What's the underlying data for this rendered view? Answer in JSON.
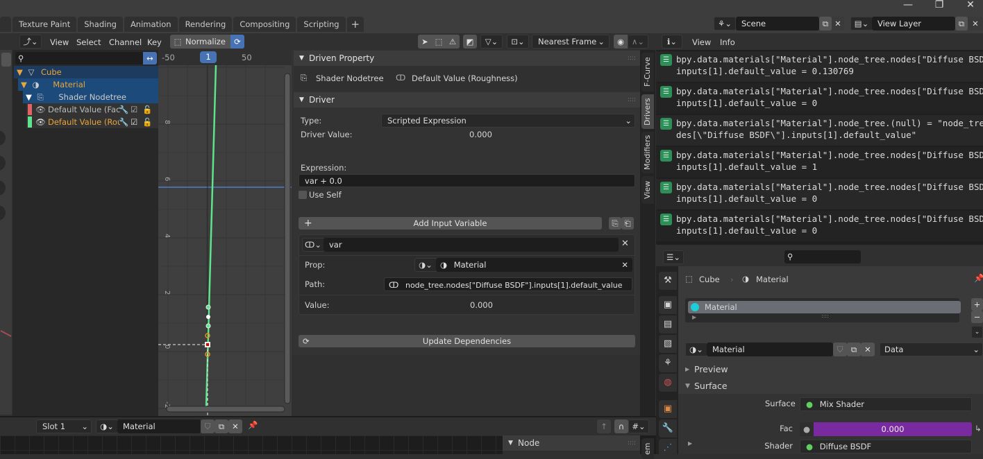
{
  "workspace_tabs": [
    "Texture Paint",
    "Shading",
    "Animation",
    "Rendering",
    "Compositing",
    "Scripting"
  ],
  "workspace_add": "+",
  "window_controls": {
    "minimize": "—",
    "maximize": "❐",
    "close": "✕"
  },
  "scene": {
    "icon": "scene-icon",
    "name": "Scene",
    "view_layer": "View Layer"
  },
  "graph_editor": {
    "menus": [
      "View",
      "Select",
      "Channel",
      "Key"
    ],
    "normalize_label": "Normalize",
    "snap_mode": "Nearest Frame",
    "frame_ruler": {
      "ticks": [
        "-50",
        "50"
      ],
      "current_frame": "1"
    },
    "y_ticks": [
      "8",
      "6",
      "4",
      "2",
      "0",
      "-2"
    ],
    "search_placeholder": ""
  },
  "outliner": {
    "items": [
      {
        "label": "Cube",
        "level": 0,
        "icon": "object-icon"
      },
      {
        "label": "Material",
        "level": 1,
        "icon": "material-icon"
      },
      {
        "label": "Shader Nodetree",
        "level": 2,
        "icon": "nodetree-icon"
      },
      {
        "label": "Default Value (Fac)",
        "level": 3,
        "color": "#e06060"
      },
      {
        "label": "Default Value (Roug",
        "level": 3,
        "color": "#5fe38c",
        "active": true
      }
    ]
  },
  "driven_property": {
    "title": "Driven Property",
    "owner": "Shader Nodetree",
    "property": "Default Value (Roughness)"
  },
  "driver": {
    "title": "Driver",
    "type_label": "Type:",
    "type_value": "Scripted Expression",
    "driver_value_label": "Driver Value:",
    "driver_value": "0.000",
    "expression_label": "Expression:",
    "expression": "var + 0.0",
    "use_self_label": "Use Self",
    "use_self": false,
    "add_variable_label": "Add Input Variable",
    "variable": {
      "name": "var",
      "prop_label": "Prop:",
      "prop_value": "Material",
      "path_label": "Path:",
      "path_value": "node_tree.nodes[\"Diffuse BSDF\"].inputs[1].default_value",
      "value_label": "Value:",
      "value": "0.000"
    },
    "update_label": "Update Dependencies"
  },
  "side_tabs": [
    "F-Curve",
    "Drivers",
    "Modifiers",
    "View"
  ],
  "active_side_tab": "Drivers",
  "info_editor": {
    "menus": [
      "View",
      "Info"
    ],
    "log": [
      {
        "line1": "bpy.data.materials[\"Material\"].node_tree.nodes[\"Diffuse BSDF\"].",
        "line2": "inputs[1].default_value = 0.130769"
      },
      {
        "line1": "bpy.data.materials[\"Material\"].node_tree.nodes[\"Diffuse BSDF\"].",
        "line2": "inputs[1].default_value = 0"
      },
      {
        "line1": "bpy.data.materials[\"Material\"].node_tree.(null) = \"node_tree.no",
        "line2": "des[\\\"Diffuse BSDF\\\"].inputs[1].default_value\""
      },
      {
        "line1": "bpy.data.materials[\"Material\"].node_tree.nodes[\"Diffuse BSDF\"].",
        "line2": "inputs[1].default_value = 1"
      },
      {
        "line1": "bpy.data.materials[\"Material\"].node_tree.nodes[\"Diffuse BSDF\"].",
        "line2": "inputs[1].default_value = 0"
      },
      {
        "line1": "bpy.data.materials[\"Material\"].node_tree.nodes[\"Diffuse BSDF\"].",
        "line2": "inputs[1].default_value = 0"
      }
    ]
  },
  "properties": {
    "breadcrumb": [
      "Cube",
      "Material"
    ],
    "slot_list": [
      "Material"
    ],
    "material_name": "Material",
    "link_mode": "Data",
    "preview_label": "Preview",
    "surface_panel_label": "Surface",
    "surface_label": "Surface",
    "surface_value": "Mix Shader",
    "fac_label": "Fac",
    "fac_value": "0.000",
    "shader_label": "Shader",
    "shader_value": "Diffuse BSDF",
    "fac_color": "#7a2aa0"
  },
  "node_editor": {
    "slot": "Slot 1",
    "material": "Material",
    "node_panel_label": "Node"
  }
}
